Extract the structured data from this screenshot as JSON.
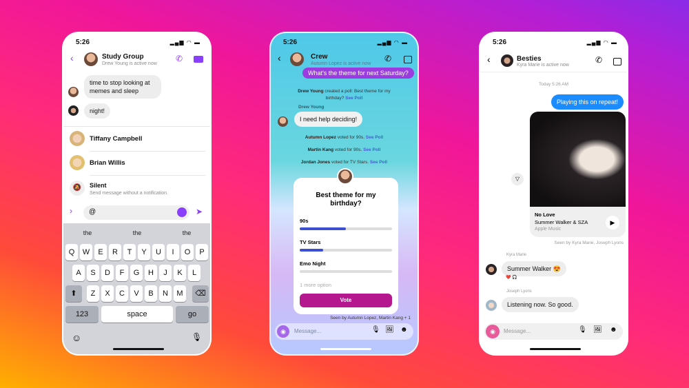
{
  "status_time": "5:26",
  "phone1": {
    "title": "Study Group",
    "subtitle": "Drew Young is active now",
    "messages": [
      "time to stop looking at memes and sleep",
      "night!"
    ],
    "mentions": [
      {
        "name": "Tiffany Campbell"
      },
      {
        "name": "Brian Willis"
      }
    ],
    "silent": {
      "label": "Silent",
      "desc": "Send message without a notification."
    },
    "input_value": "@",
    "suggestions": [
      "the",
      "the",
      "the"
    ],
    "keyboard": {
      "row1": [
        "Q",
        "W",
        "E",
        "R",
        "T",
        "Y",
        "U",
        "I",
        "O",
        "P"
      ],
      "row2": [
        "A",
        "S",
        "D",
        "F",
        "G",
        "H",
        "J",
        "K",
        "L"
      ],
      "row3": [
        "Z",
        "X",
        "C",
        "V",
        "B",
        "N",
        "M"
      ],
      "numbers": "123",
      "space": "space",
      "go": "go"
    },
    "accent": "#8a3ffc"
  },
  "phone2": {
    "title": "Crew",
    "subtitle": "Autumn Lopez is active now",
    "sent_message": "What's the theme for next Saturday?",
    "poll_created": {
      "name": "Drew Young",
      "text": " created a poll: Best theme for my birthday? ",
      "link": "See Poll"
    },
    "sender": "Drew Young",
    "message": "I need help deciding!",
    "votes": [
      {
        "name": "Autumn Lopez",
        "text": " voted for 90s. ",
        "link": "See Poll"
      },
      {
        "name": "Martin Kang",
        "text": " voted for 90s. ",
        "link": "See Poll"
      },
      {
        "name": "Jordan Jones",
        "text": " voted for TV Stars. ",
        "link": "See Poll"
      }
    ],
    "poll": {
      "question": "Best theme for my birthday?",
      "options": [
        {
          "label": "90s",
          "fraction": 0.5
        },
        {
          "label": "TV Stars",
          "fraction": 0.25
        },
        {
          "label": "Emo Night",
          "fraction": 0
        }
      ],
      "more": "1 more option",
      "vote_label": "Vote"
    },
    "seen": "Seen by Autumn Lopez, Martin Kang + 1",
    "placeholder": "Message..."
  },
  "phone3": {
    "title": "Besties",
    "subtitle": "Kyra Marie is active now",
    "timestamp": "Today 5:26 AM",
    "sent_message": "Playing this on repeat!",
    "song": {
      "title": "No Love",
      "artist": "Summer Walker & SZA",
      "service": "Apple Music"
    },
    "seen": "Seen by Kyra Marie, Joseph Lyons",
    "messages": [
      {
        "sender": "Kyra Marie",
        "text": "Summer Walker 😍",
        "reactions": "❤️ 🎧"
      },
      {
        "sender": "Joseph Lyons",
        "text": "Listening now. So good."
      }
    ],
    "placeholder": "Message...",
    "accent": "#1a8cff"
  }
}
